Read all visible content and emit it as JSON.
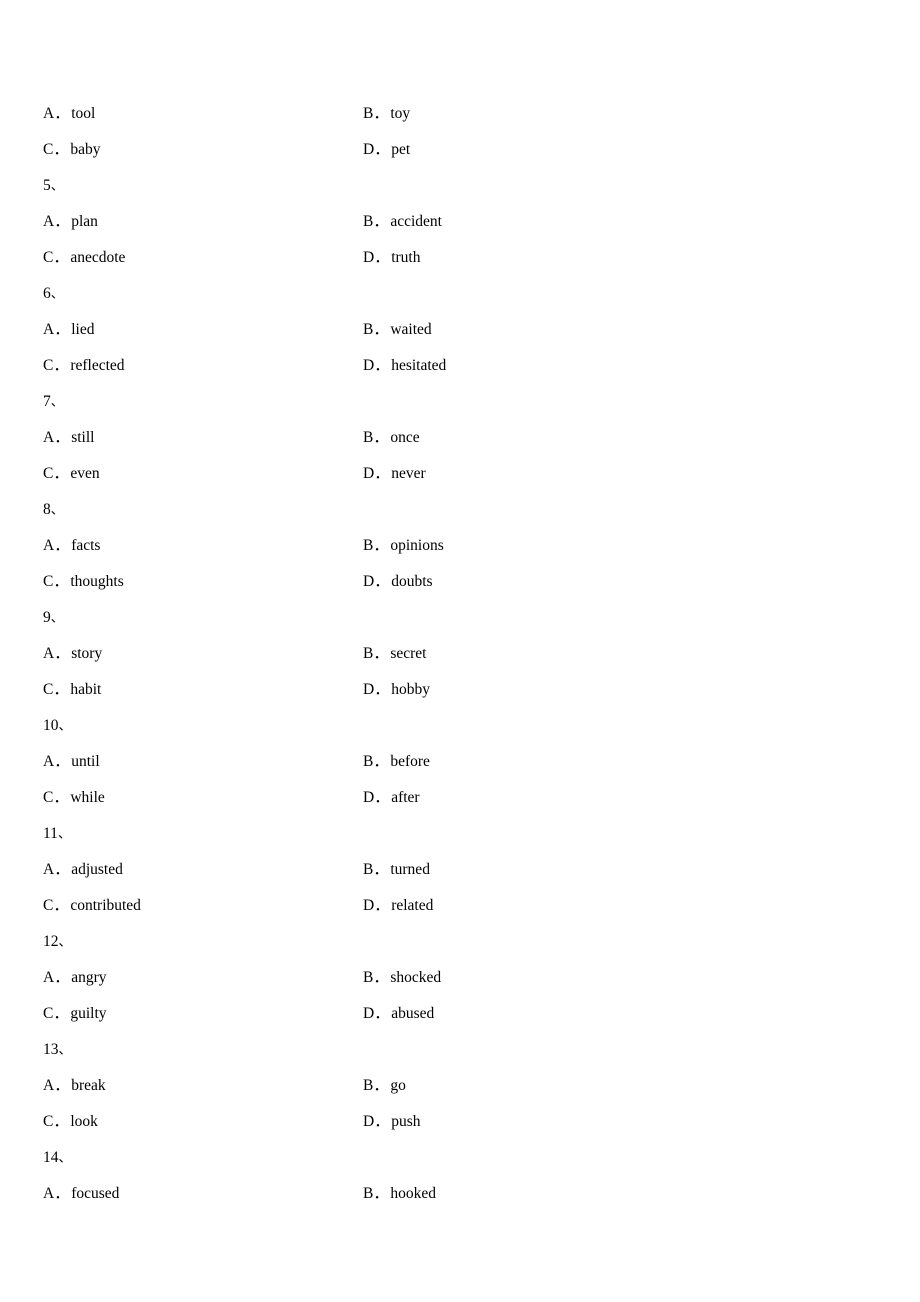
{
  "document": {
    "page_background": "#ffffff",
    "text_color": "#000000",
    "question_marker_suffix": "、",
    "option_separator": "．"
  },
  "lines": [
    {
      "type": "options",
      "left": {
        "letter": "A",
        "word": "tool"
      },
      "right": {
        "letter": "B",
        "word": "toy"
      }
    },
    {
      "type": "options",
      "left": {
        "letter": "C",
        "word": "baby"
      },
      "right": {
        "letter": "D",
        "word": "pet"
      }
    },
    {
      "type": "question",
      "number": "5"
    },
    {
      "type": "options",
      "left": {
        "letter": "A",
        "word": "plan"
      },
      "right": {
        "letter": "B",
        "word": "accident"
      }
    },
    {
      "type": "options",
      "left": {
        "letter": "C",
        "word": "anecdote"
      },
      "right": {
        "letter": "D",
        "word": "truth"
      }
    },
    {
      "type": "question",
      "number": "6"
    },
    {
      "type": "options",
      "left": {
        "letter": "A",
        "word": "lied"
      },
      "right": {
        "letter": "B",
        "word": "waited"
      }
    },
    {
      "type": "options",
      "left": {
        "letter": "C",
        "word": "reflected"
      },
      "right": {
        "letter": "D",
        "word": "hesitated"
      }
    },
    {
      "type": "question",
      "number": "7"
    },
    {
      "type": "options",
      "left": {
        "letter": "A",
        "word": "still"
      },
      "right": {
        "letter": "B",
        "word": "once"
      }
    },
    {
      "type": "options",
      "left": {
        "letter": "C",
        "word": "even"
      },
      "right": {
        "letter": "D",
        "word": "never"
      }
    },
    {
      "type": "question",
      "number": "8"
    },
    {
      "type": "options",
      "left": {
        "letter": "A",
        "word": "facts"
      },
      "right": {
        "letter": "B",
        "word": "opinions"
      }
    },
    {
      "type": "options",
      "left": {
        "letter": "C",
        "word": "thoughts"
      },
      "right": {
        "letter": "D",
        "word": "doubts"
      }
    },
    {
      "type": "question",
      "number": "9"
    },
    {
      "type": "options",
      "left": {
        "letter": "A",
        "word": "story"
      },
      "right": {
        "letter": "B",
        "word": "secret"
      }
    },
    {
      "type": "options",
      "left": {
        "letter": "C",
        "word": "habit"
      },
      "right": {
        "letter": "D",
        "word": "hobby"
      }
    },
    {
      "type": "question",
      "number": "10"
    },
    {
      "type": "options",
      "left": {
        "letter": "A",
        "word": "until"
      },
      "right": {
        "letter": "B",
        "word": "before"
      }
    },
    {
      "type": "options",
      "left": {
        "letter": "C",
        "word": "while"
      },
      "right": {
        "letter": "D",
        "word": "after"
      }
    },
    {
      "type": "question",
      "number": "11"
    },
    {
      "type": "options",
      "left": {
        "letter": "A",
        "word": "adjusted"
      },
      "right": {
        "letter": "B",
        "word": "turned"
      }
    },
    {
      "type": "options",
      "left": {
        "letter": "C",
        "word": "contributed"
      },
      "right": {
        "letter": "D",
        "word": "related"
      }
    },
    {
      "type": "question",
      "number": "12"
    },
    {
      "type": "options",
      "left": {
        "letter": "A",
        "word": "angry"
      },
      "right": {
        "letter": "B",
        "word": "shocked"
      }
    },
    {
      "type": "options",
      "left": {
        "letter": "C",
        "word": "guilty"
      },
      "right": {
        "letter": "D",
        "word": "abused"
      }
    },
    {
      "type": "question",
      "number": "13"
    },
    {
      "type": "options",
      "left": {
        "letter": "A",
        "word": "break"
      },
      "right": {
        "letter": "B",
        "word": "go"
      }
    },
    {
      "type": "options",
      "left": {
        "letter": "C",
        "word": "look"
      },
      "right": {
        "letter": "D",
        "word": "push"
      }
    },
    {
      "type": "question",
      "number": "14"
    },
    {
      "type": "options",
      "left": {
        "letter": "A",
        "word": "focused"
      },
      "right": {
        "letter": "B",
        "word": "hooked"
      }
    }
  ]
}
